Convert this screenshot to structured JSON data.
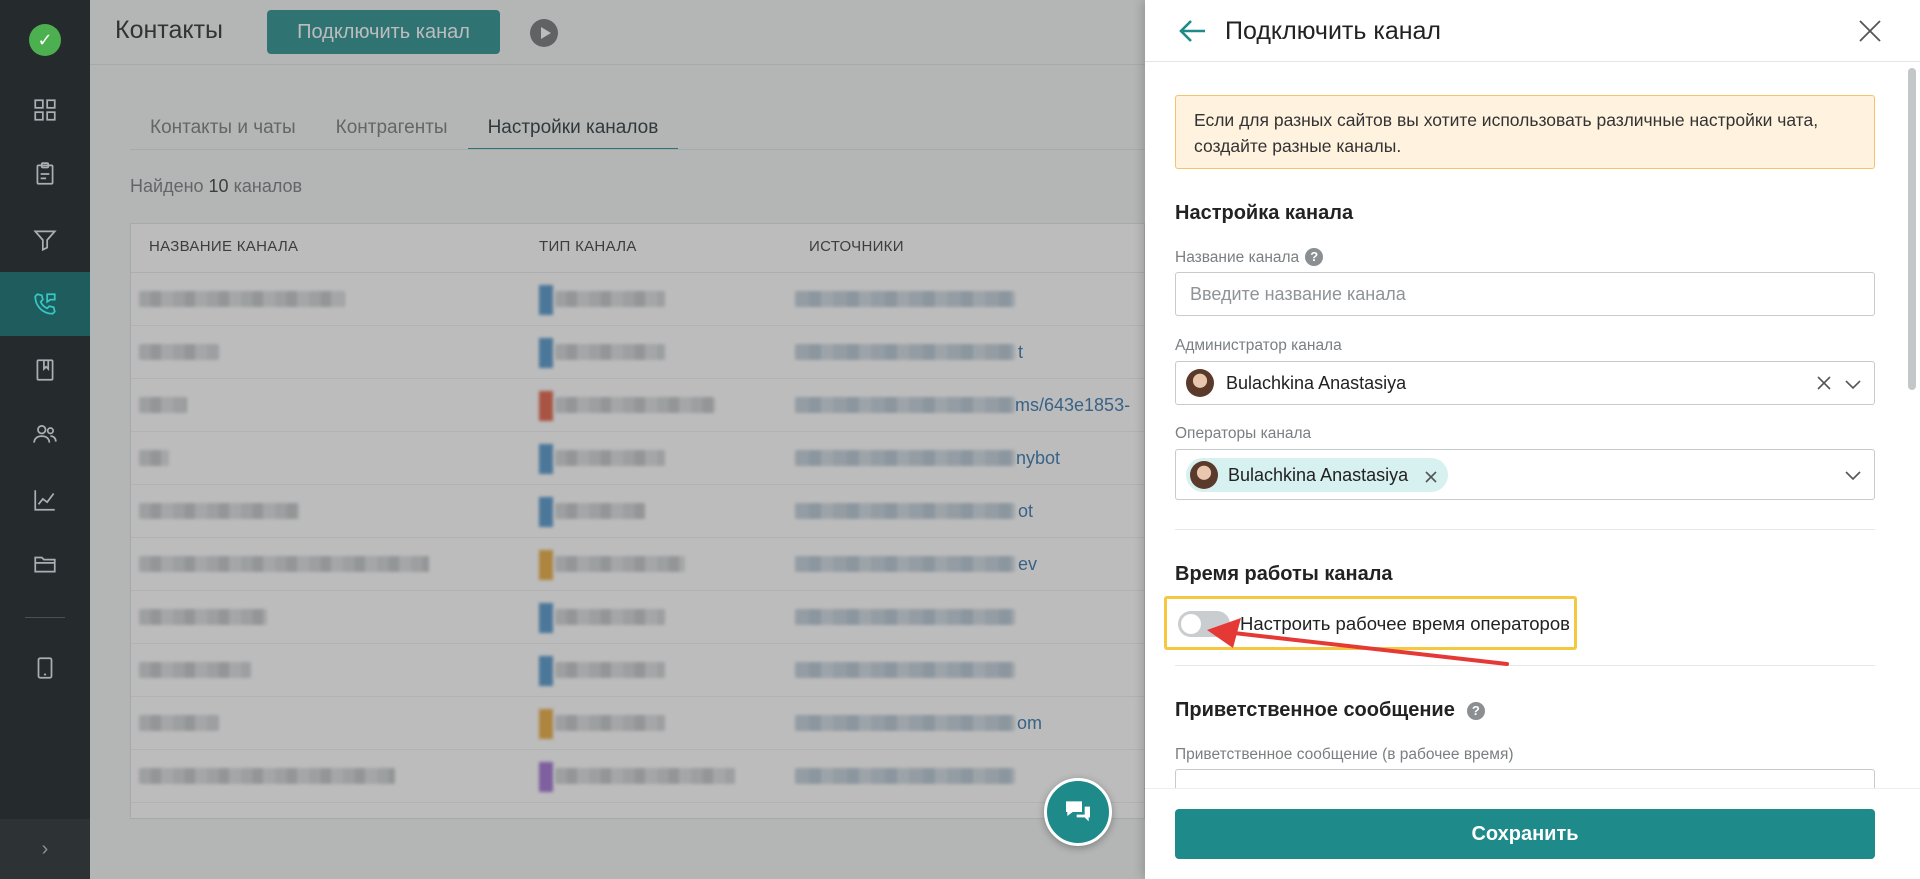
{
  "header": {
    "title": "Контакты",
    "connect_button": "Подключить канал"
  },
  "tabs": [
    {
      "label": "Контакты и чаты"
    },
    {
      "label": "Контрагенты"
    },
    {
      "label": "Настройки каналов"
    }
  ],
  "found": {
    "prefix": "Найдено",
    "count": "10",
    "suffix": "каналов"
  },
  "table": {
    "columns": [
      "НАЗВАНИЕ КАНАЛА",
      "ТИП КАНАЛА",
      "ИСТОЧНИКИ"
    ],
    "visible_fragments": [
      "t",
      "ms/643e1853-",
      "nybot",
      "ot",
      "ev",
      "om"
    ]
  },
  "sidebar": {
    "items": [
      "dashboard-icon",
      "clipboard-icon",
      "filter-icon",
      "phone-chat-icon",
      "book-icon",
      "users-icon",
      "chart-icon",
      "folder-icon",
      "tablet-icon"
    ],
    "expand_glyph": "›"
  },
  "drawer": {
    "title": "Подключить канал",
    "notice": "Если для разных сайтов вы хотите использовать различные настройки чата, создайте разные каналы.",
    "channel_settings": {
      "title": "Настройка канала",
      "name_label": "Название канала",
      "name_placeholder": "Введите название канала",
      "admin_label": "Администратор канала",
      "admin_value": "Bulachkina Anastasiya",
      "operators_label": "Операторы канала",
      "operators": [
        "Bulachkina Anastasiya"
      ]
    },
    "work_time": {
      "title": "Время работы канала",
      "toggle_label": "Настроить рабочее время операторов",
      "toggle_on": false
    },
    "greeting": {
      "title": "Приветственное сообщение",
      "field_label": "Приветственное сообщение (в рабочее время)"
    },
    "save_button": "Сохранить"
  },
  "colors": {
    "accent": "#1e8a8a",
    "sidebar_bg": "#252a2c",
    "notice_bg": "#fff3e0",
    "highlight": "#f5c842",
    "annotation_arrow": "#e53935"
  }
}
